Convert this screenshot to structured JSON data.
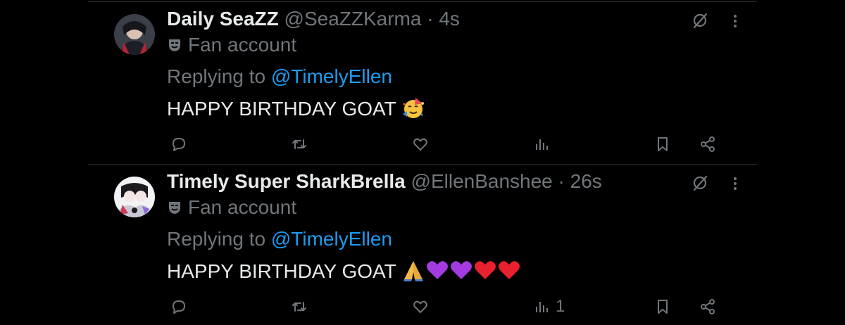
{
  "tweets": [
    {
      "display_name": "Daily SeaZZ",
      "handle": "@SeaZZKarma",
      "separator": "·",
      "time": "4s",
      "badge": "Fan account",
      "replying_prefix": "Replying to ",
      "replying_to": "@TimelyEllen",
      "text": "HAPPY BIRTHDAY GOAT",
      "emojis": [
        "partying-face"
      ],
      "views_count": ""
    },
    {
      "display_name": "Timely Super SharkBrella",
      "handle": "@EllenBanshee",
      "separator": "·",
      "time": "26s",
      "badge": "Fan account",
      "replying_prefix": "Replying to ",
      "replying_to": "@TimelyEllen",
      "text": "HAPPY BIRTHDAY GOAT",
      "emojis": [
        "folded-hands",
        "purple-heart",
        "purple-heart",
        "red-heart",
        "red-heart"
      ],
      "views_count": "1"
    }
  ],
  "icons": {
    "badge": "theater-masks-icon",
    "grok": "grok-icon",
    "more": "more-icon",
    "reply": "reply-icon",
    "retweet": "retweet-icon",
    "like": "like-icon",
    "views": "views-icon",
    "bookmark": "bookmark-icon",
    "share": "share-icon"
  },
  "colors": {
    "background": "#000000",
    "text": "#e7e9ea",
    "secondary": "#71767b",
    "link": "#1d9bf0",
    "divider": "#2f3336"
  }
}
